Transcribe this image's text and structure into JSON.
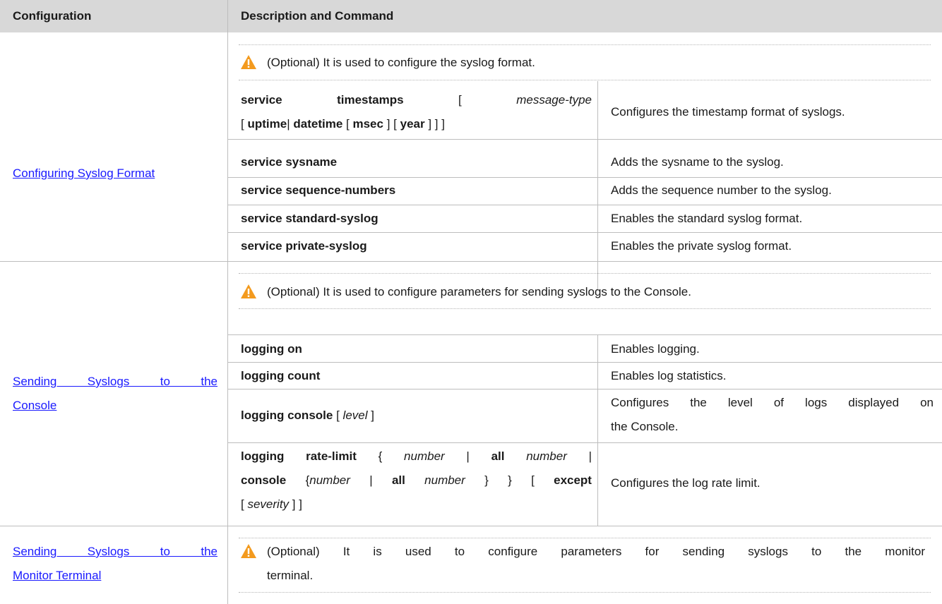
{
  "header": {
    "col1": "Configuration",
    "col2": "Description and Command"
  },
  "icons": {
    "note_icon": "warning-triangle-icon",
    "note_color": "#f39a1e"
  },
  "colors": {
    "link": "#1a1aff",
    "header_bg": "#d8d8d8"
  },
  "sections": [
    {
      "config": "Configuring Syslog Format",
      "note": "(Optional) It is used to configure the syslog format.",
      "rows": [
        {
          "cmd_1": {
            "k1": "service",
            "k2": "timestamps",
            "b1": "[",
            "arg": "message-type"
          },
          "cmd_2": {
            "b1": "[",
            "k1": "uptime",
            "b2": "|",
            "k2": "datetime",
            "b3": "[",
            "k3": "msec",
            "b4": "] [",
            "k4": "year",
            "b5": "] ] ]"
          },
          "desc": "Configures the timestamp format of syslogs."
        },
        {
          "cmd": "service sysname",
          "desc": "Adds the sysname to the syslog."
        },
        {
          "cmd": "service sequence-numbers",
          "desc": "Adds the sequence number to the syslog."
        },
        {
          "cmd": "service standard-syslog",
          "desc": "Enables the standard syslog format."
        },
        {
          "cmd": "service private-syslog",
          "desc": "Enables the private syslog format."
        }
      ]
    },
    {
      "config_1": "Sending Syslogs to the",
      "config_2": "Console",
      "note": "(Optional) It is used to configure parameters for sending syslogs to the Console.",
      "rows": [
        {
          "cmd": "logging on",
          "desc": "Enables logging."
        },
        {
          "cmd": "logging count",
          "desc": "Enables log statistics."
        },
        {
          "cmd": {
            "k1": "logging console",
            "b1": "[",
            "arg": "level",
            "b2": "]"
          },
          "desc_1": "Configures the level of logs displayed on",
          "desc_2": "the Console."
        },
        {
          "cmd_1": {
            "k1": "logging rate-limit",
            "b1": "{",
            "a1": "number",
            "b2": "|",
            "k2": "all",
            "a2": "number",
            "b3": "|"
          },
          "cmd_2": {
            "k1": "console",
            "b1": "{",
            "a1": "number",
            "b2": "|",
            "k2": "all",
            "a2": "number",
            "b3": "} } [",
            "k3": "except"
          },
          "cmd_3": {
            "b1": "[",
            "a1": "severity",
            "b2": "] ]"
          },
          "desc": "Configures the log rate limit."
        }
      ]
    },
    {
      "config_1": "Sending Syslogs to the",
      "config_2": "Monitor Terminal",
      "note_1": "(Optional) It is used to configure parameters for sending syslogs to the monitor",
      "note_2": "terminal."
    }
  ]
}
